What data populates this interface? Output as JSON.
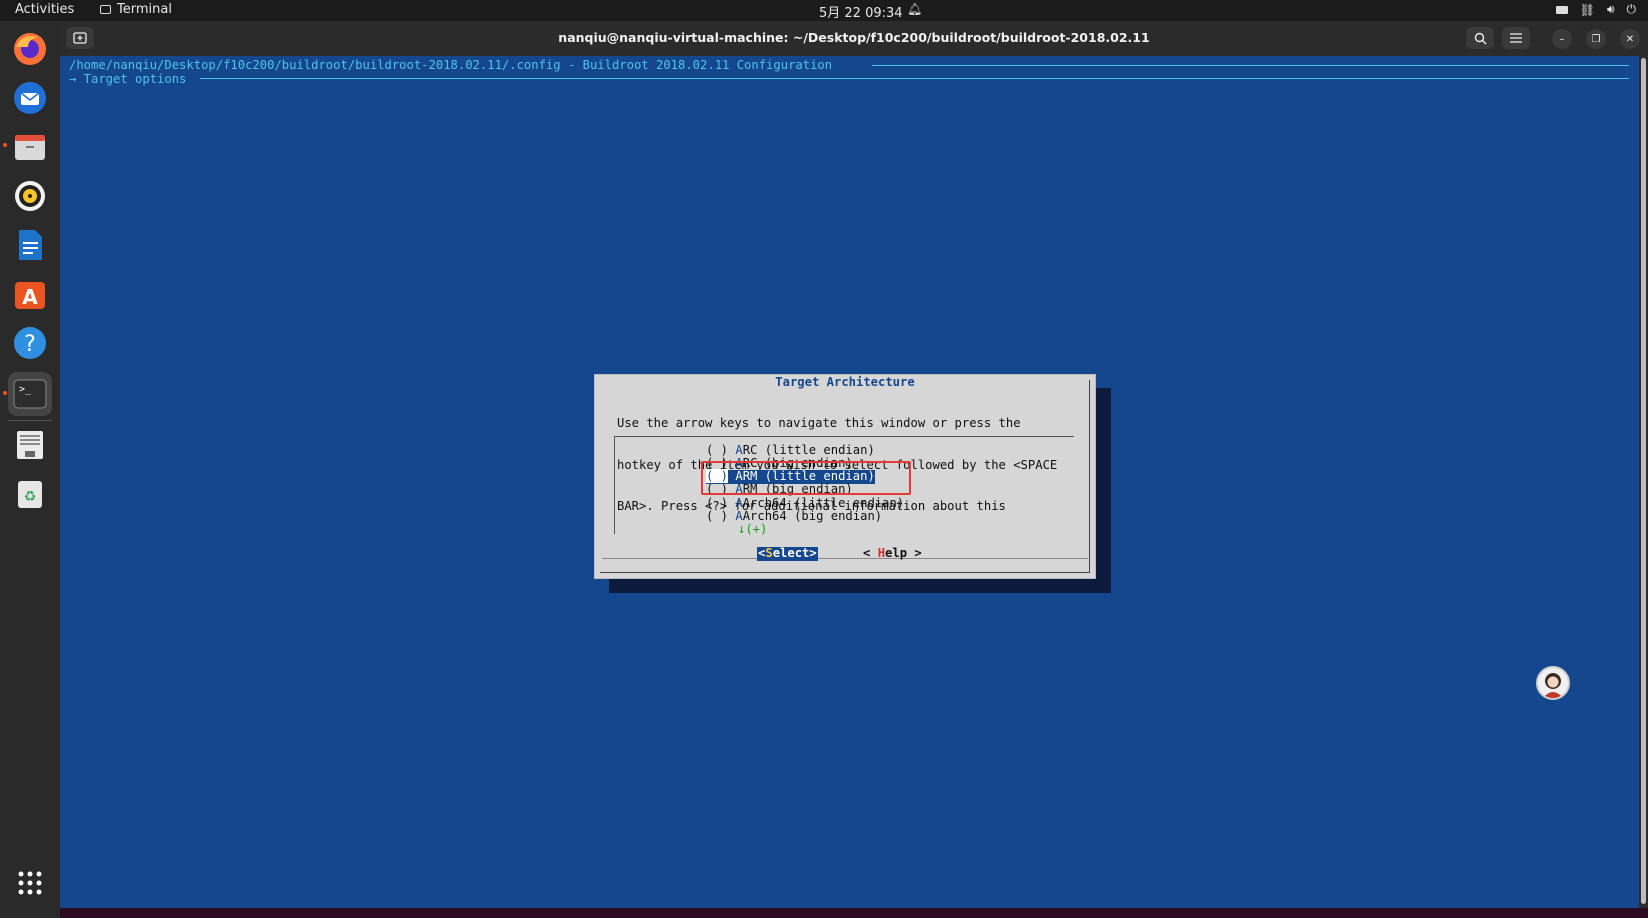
{
  "topbar": {
    "activities": "Activities",
    "app_name": "Terminal",
    "clock": "5月 22  09:34"
  },
  "dock": {
    "apps": [
      "firefox",
      "thunderbird",
      "files",
      "rhythmbox",
      "libreoffice-writer",
      "app-center",
      "help",
      "terminal",
      "file-manager",
      "trash",
      "show-apps"
    ]
  },
  "window": {
    "title": "nanqiu@nanqiu-virtual-machine: ~/Desktop/f10c200/buildroot/buildroot-2018.02.11"
  },
  "terminal": {
    "config_path": "/home/nanqiu/Desktop/f10c200/buildroot/buildroot-2018.02.11/.config - Buildroot 2018.02.11 Configuration",
    "breadcrumb": "→ Target options",
    "dialog": {
      "title": "Target Architecture",
      "help_lines": [
        "Use the arrow keys to navigate this window or press the",
        "hotkey of the item you wish to select followed by the <SPACE",
        "BAR>. Press <?> for additional information about this"
      ],
      "options": [
        {
          "box": "( )",
          "label": "ARC (little endian)",
          "selected": false
        },
        {
          "box": "( )",
          "label": "ARC (big endian)",
          "selected": false
        },
        {
          "box": "( )",
          "label": "ARM (little endian)",
          "selected": true
        },
        {
          "box": "( )",
          "label": "ARM (big endian)",
          "selected": false
        },
        {
          "box": "( )",
          "label": "AArch64 (little endian)",
          "selected": false
        },
        {
          "box": "( )",
          "label": "AArch64 (big endian)",
          "selected": false
        }
      ],
      "more_indicator": "↓(+)",
      "select_button": "<Select>",
      "help_button": "< Help >"
    }
  },
  "colors": {
    "terminal_bg": "#14478d",
    "highlight_box": "#e53935",
    "dialog_bg": "#d6d6d6"
  }
}
